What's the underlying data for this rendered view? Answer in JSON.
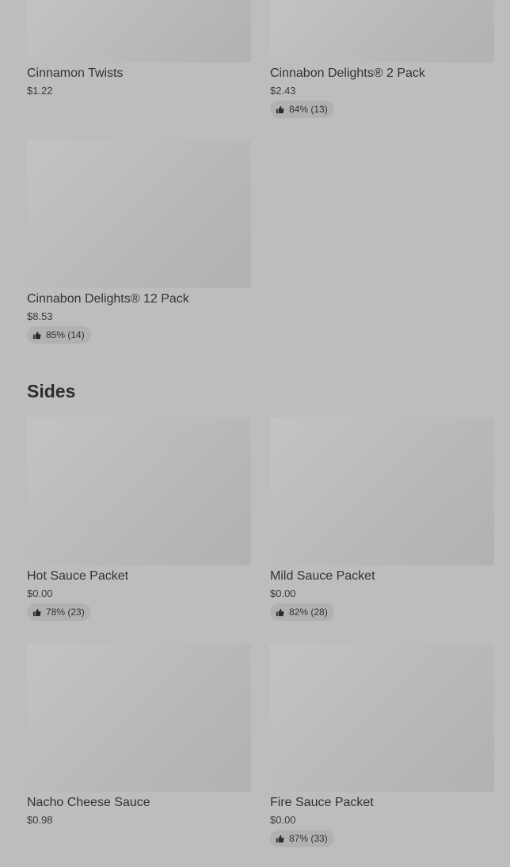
{
  "sections": {
    "sides_title": "Sides"
  },
  "icons": {
    "rating": "thumbs-up-icon"
  },
  "colors": {
    "background": "#bdbdbd",
    "image_placeholder": "#bababa",
    "rating_pill": "#b1b1b1"
  },
  "items": [
    {
      "name": "Cinnamon Twists",
      "price": "$1.22",
      "rating": null
    },
    {
      "name": "Cinnabon Delights® 2 Pack",
      "price": "$2.43",
      "rating": "84% (13)"
    },
    {
      "name": "Cinnabon Delights® 12 Pack",
      "price": "$8.53",
      "rating": "85% (14)"
    },
    {
      "name": "Hot Sauce Packet",
      "price": "$0.00",
      "rating": "78% (23)"
    },
    {
      "name": "Mild Sauce Packet",
      "price": "$0.00",
      "rating": "82% (28)"
    },
    {
      "name": "Nacho Cheese Sauce",
      "price": "$0.98",
      "rating": null
    },
    {
      "name": "Fire Sauce Packet",
      "price": "$0.00",
      "rating": "87% (33)"
    }
  ]
}
